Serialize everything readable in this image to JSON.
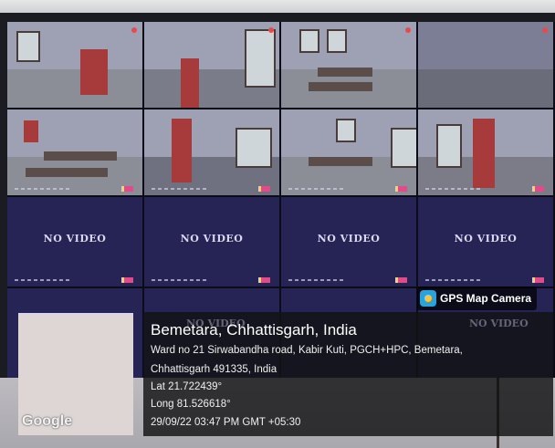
{
  "cameras": {
    "no_video_label": "NO VIDEO",
    "overlay_no_video_left": "NO VIDEO",
    "overlay_no_video_right": "NO VIDEO"
  },
  "watermark": {
    "app_name": "GPS Map Camera",
    "map_provider": "Google",
    "location_title": "Bemetara, Chhattisgarh, India",
    "address_line1": "Ward no 21 Sirwabandha road, Kabir Kuti, PGCH+HPC, Bemetara,",
    "address_line2": "Chhattisgarh 491335, India",
    "latitude": "Lat 21.722439°",
    "longitude": "Long 81.526618°",
    "datetime": "29/09/22 03:47 PM GMT +05:30"
  },
  "colors": {
    "no_video_bg": "#262454",
    "overlay_bg": "#121214",
    "badge_icon": "#2aa3dc"
  }
}
